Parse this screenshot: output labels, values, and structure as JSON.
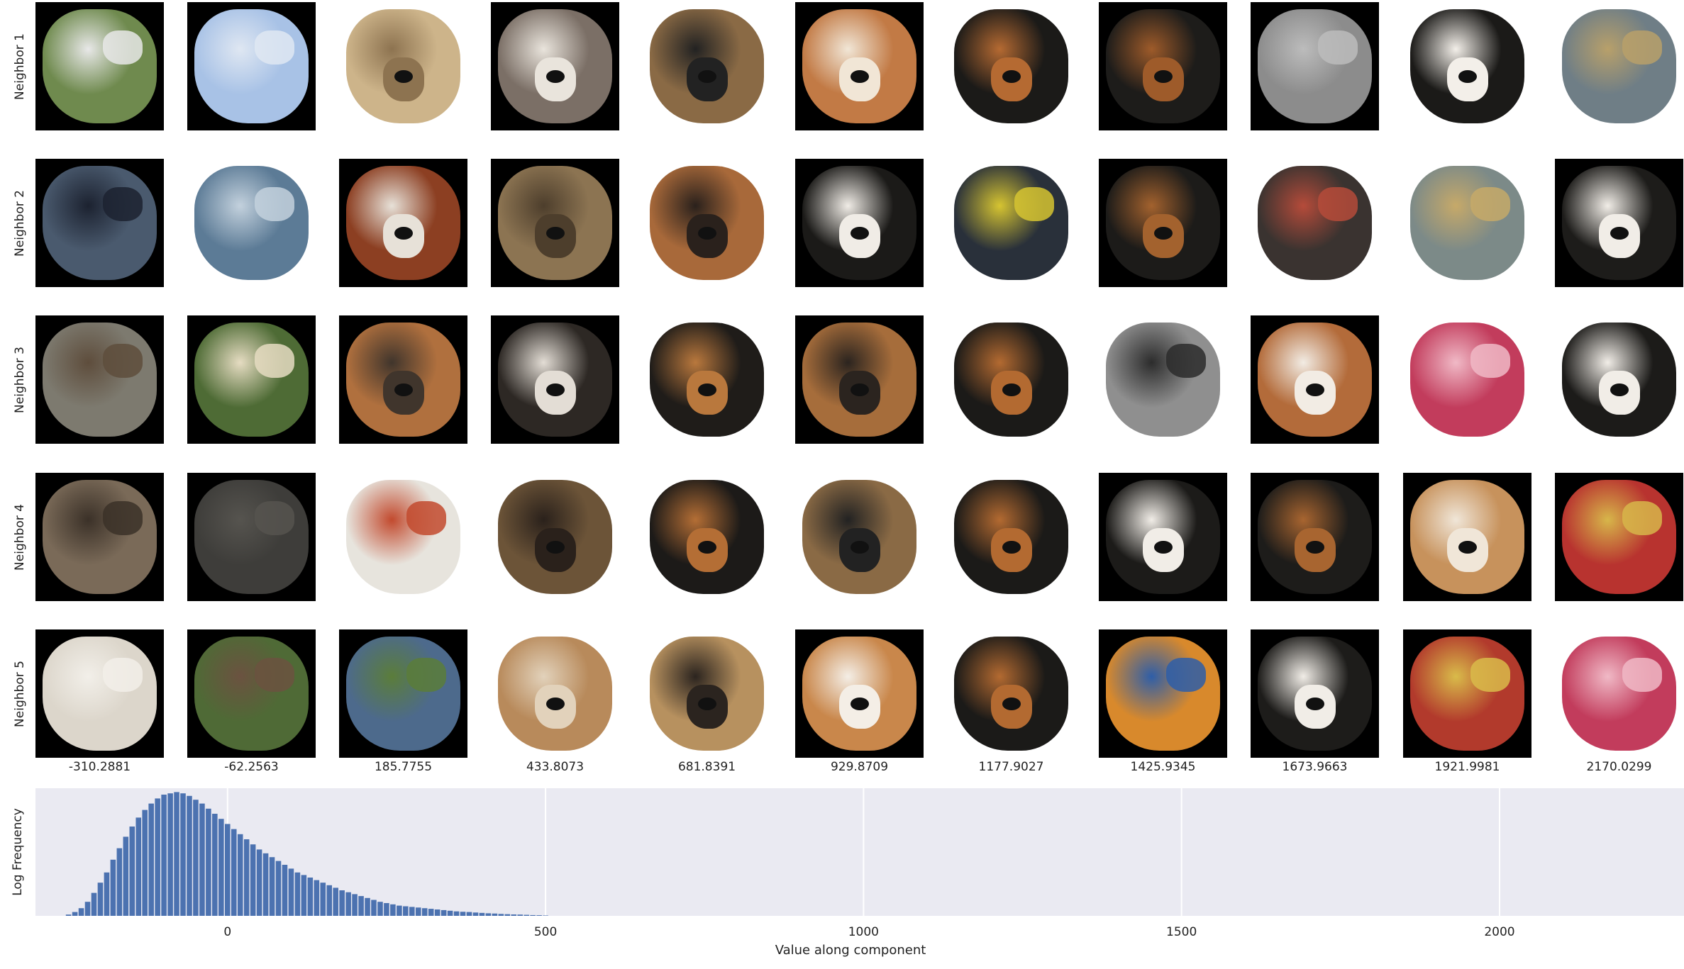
{
  "figure": {
    "row_labels": [
      "Neighbor 1",
      "Neighbor 2",
      "Neighbor 3",
      "Neighbor 4",
      "Neighbor 5"
    ],
    "column_values": [
      "-310.2881",
      "-62.2563",
      "185.7755",
      "433.8073",
      "681.8391",
      "929.8709",
      "1177.9027",
      "1425.9345",
      "1673.9663",
      "1921.9981",
      "2170.0299"
    ],
    "tiles": [
      [
        {
          "depicts": "aerial landscape",
          "bg": "#000000",
          "color": "#6f8a4e",
          "accent": "#e8e8e8",
          "dog": false
        },
        {
          "depicts": "sky with clouds",
          "bg": "#000000",
          "color": "#a8c2e6",
          "accent": "#dfe7f2",
          "dog": false
        },
        {
          "depicts": "terrier dog",
          "bg": "#ffffff",
          "color": "#cdb48a",
          "accent": "#8d7350",
          "dog": true
        },
        {
          "depicts": "merle dog",
          "bg": "#000000",
          "color": "#7b6f66",
          "accent": "#e9e4dc",
          "dog": true
        },
        {
          "depicts": "group of dogs",
          "bg": "#ffffff",
          "color": "#8a6a45",
          "accent": "#222222",
          "dog": true
        },
        {
          "depicts": "orange dog face",
          "bg": "#000000",
          "color": "#c27a45",
          "accent": "#f1e6d6",
          "dog": true
        },
        {
          "depicts": "bernese dog face",
          "bg": "#ffffff",
          "color": "#1b1a18",
          "accent": "#b56a32",
          "dog": true
        },
        {
          "depicts": "bernese puppies",
          "bg": "#000000",
          "color": "#1d1c1a",
          "accent": "#9e5b2a",
          "dog": true
        },
        {
          "depicts": "grey grate pattern",
          "bg": "#000000",
          "color": "#8c8c8c",
          "accent": "#bcbcbc",
          "dog": false
        },
        {
          "depicts": "bernese puppies",
          "bg": "#ffffff",
          "color": "#1b1a18",
          "accent": "#f3efe9",
          "dog": true
        },
        {
          "depicts": "bottle caps",
          "bg": "#ffffff",
          "color": "#6f7e86",
          "accent": "#b8a06a",
          "dog": false
        }
      ],
      [
        {
          "depicts": "dark scene",
          "bg": "#000000",
          "color": "#4a5a6e",
          "accent": "#1c2230",
          "dog": false
        },
        {
          "depicts": "water surface",
          "bg": "#ffffff",
          "color": "#5c7b96",
          "accent": "#c3d1dd",
          "dog": false
        },
        {
          "depicts": "spaniel dogs",
          "bg": "#000000",
          "color": "#8c3f22",
          "accent": "#e7e1d8",
          "dog": true
        },
        {
          "depicts": "yorkshire terrier",
          "bg": "#000000",
          "color": "#8c7452",
          "accent": "#4d3e2c",
          "dog": true
        },
        {
          "depicts": "fluffy dog face",
          "bg": "#ffffff",
          "color": "#a8693a",
          "accent": "#2a211c",
          "dog": true
        },
        {
          "depicts": "bernese dog",
          "bg": "#000000",
          "color": "#1b1a18",
          "accent": "#f0ece6",
          "dog": true
        },
        {
          "depicts": "bottle caps",
          "bg": "#ffffff",
          "color": "#29303a",
          "accent": "#d6c431",
          "dog": false
        },
        {
          "depicts": "bernese puppies",
          "bg": "#000000",
          "color": "#1c1b19",
          "accent": "#a3622e",
          "dog": true
        },
        {
          "depicts": "bottle caps",
          "bg": "#ffffff",
          "color": "#3a3330",
          "accent": "#b54b3a",
          "dog": false
        },
        {
          "depicts": "bottle caps",
          "bg": "#ffffff",
          "color": "#7c8a88",
          "accent": "#c6a969",
          "dog": false
        },
        {
          "depicts": "bernese puppies",
          "bg": "#000000",
          "color": "#1d1c1a",
          "accent": "#f1ede7",
          "dog": true
        }
      ],
      [
        {
          "depicts": "wooden surface",
          "bg": "#000000",
          "color": "#7d7a6f",
          "accent": "#5e4d3c",
          "dog": false
        },
        {
          "depicts": "dogs on grass",
          "bg": "#000000",
          "color": "#4e6b35",
          "accent": "#e6dcc2",
          "dog": false
        },
        {
          "depicts": "small dog face",
          "bg": "#000000",
          "color": "#b0703e",
          "accent": "#40352c",
          "dog": true
        },
        {
          "depicts": "collie face",
          "bg": "#000000",
          "color": "#2d2824",
          "accent": "#e3ddd5",
          "dog": true
        },
        {
          "depicts": "tricolor puppy",
          "bg": "#ffffff",
          "color": "#1f1c19",
          "accent": "#b9783d",
          "dog": true
        },
        {
          "depicts": "chihuahua pair",
          "bg": "#000000",
          "color": "#a66d3b",
          "accent": "#2b241f",
          "dog": true
        },
        {
          "depicts": "bernese dog face",
          "bg": "#ffffff",
          "color": "#1b1a18",
          "accent": "#b36a31",
          "dog": true
        },
        {
          "depicts": "grey grate pattern",
          "bg": "#ffffff",
          "color": "#8f8f8f",
          "accent": "#2c2c2c",
          "dog": false
        },
        {
          "depicts": "cavalier puppies",
          "bg": "#000000",
          "color": "#b36b3a",
          "accent": "#f2ece4",
          "dog": true
        },
        {
          "depicts": "red bottle caps",
          "bg": "#ffffff",
          "color": "#c23c5c",
          "accent": "#f0b9c6",
          "dog": false
        },
        {
          "depicts": "bernese puppies",
          "bg": "#ffffff",
          "color": "#1c1b19",
          "accent": "#f1ede7",
          "dog": true
        }
      ],
      [
        {
          "depicts": "dark interior",
          "bg": "#000000",
          "color": "#7a6a58",
          "accent": "#3b3128",
          "dog": false
        },
        {
          "depicts": "dark animal",
          "bg": "#000000",
          "color": "#3e3d3a",
          "accent": "#56544f",
          "dog": false
        },
        {
          "depicts": "painted van",
          "bg": "#ffffff",
          "color": "#e7e4dd",
          "accent": "#c24a2e",
          "dog": false
        },
        {
          "depicts": "terrier dog",
          "bg": "#ffffff",
          "color": "#6c5438",
          "accent": "#2a211b",
          "dog": true
        },
        {
          "depicts": "swiss mountain dog",
          "bg": "#ffffff",
          "color": "#1c1a18",
          "accent": "#b46e35",
          "dog": true
        },
        {
          "depicts": "group of dogs",
          "bg": "#ffffff",
          "color": "#8a6a45",
          "accent": "#222222",
          "dog": true
        },
        {
          "depicts": "bernese dog face",
          "bg": "#ffffff",
          "color": "#1b1a18",
          "accent": "#b36a31",
          "dog": true
        },
        {
          "depicts": "bernese puppies",
          "bg": "#000000",
          "color": "#1c1b19",
          "accent": "#f1ede7",
          "dog": true
        },
        {
          "depicts": "bernese puppies",
          "bg": "#000000",
          "color": "#1d1c1a",
          "accent": "#a86530",
          "dog": true
        },
        {
          "depicts": "corgi puppies",
          "bg": "#000000",
          "color": "#c7925c",
          "accent": "#f0e6d8",
          "dog": true
        },
        {
          "depicts": "bottle caps",
          "bg": "#000000",
          "color": "#b8332f",
          "accent": "#d7b64a",
          "dog": false
        }
      ],
      [
        {
          "depicts": "white sheet",
          "bg": "#000000",
          "color": "#dcd6cb",
          "accent": "#f2efe9",
          "dog": false
        },
        {
          "depicts": "animals on grass",
          "bg": "#000000",
          "color": "#4f6a36",
          "accent": "#6b5240",
          "dog": false
        },
        {
          "depicts": "dog outdoors",
          "bg": "#000000",
          "color": "#4d6a8c",
          "accent": "#5b7d3a",
          "dog": false
        },
        {
          "depicts": "two dogs",
          "bg": "#ffffff",
          "color": "#b88a5b",
          "accent": "#e2d2bb",
          "dog": true
        },
        {
          "depicts": "golden dogs",
          "bg": "#ffffff",
          "color": "#b7915f",
          "accent": "#2b241f",
          "dog": true
        },
        {
          "depicts": "corgi face",
          "bg": "#000000",
          "color": "#c9874b",
          "accent": "#f4eee6",
          "dog": true
        },
        {
          "depicts": "bernese dog face",
          "bg": "#ffffff",
          "color": "#1b1a18",
          "accent": "#b36a31",
          "dog": true
        },
        {
          "depicts": "colorful bottle caps",
          "bg": "#000000",
          "color": "#d8892c",
          "accent": "#2e5ea8",
          "dog": false
        },
        {
          "depicts": "bernese puppies",
          "bg": "#000000",
          "color": "#1d1c1a",
          "accent": "#f1ede7",
          "dog": true
        },
        {
          "depicts": "bottle caps",
          "bg": "#000000",
          "color": "#b23a2c",
          "accent": "#d9bb4a",
          "dog": false
        },
        {
          "depicts": "red bottle caps",
          "bg": "#ffffff",
          "color": "#c23c5c",
          "accent": "#f0b9c6",
          "dog": false
        }
      ]
    ]
  },
  "chart_data": {
    "type": "bar",
    "title": "",
    "xlabel": "Value along component",
    "ylabel": "Log Frequency",
    "xlim": [
      -302,
      2290
    ],
    "ylim": [
      0,
      100
    ],
    "grid": true,
    "xticks": [
      0,
      500,
      1000,
      1500,
      2000
    ],
    "xtick_labels": [
      "0",
      "500",
      "1000",
      "1500",
      "2000"
    ],
    "bin_width": 10,
    "bin_starts": [
      -255,
      -245,
      -235,
      -225,
      -215,
      -205,
      -195,
      -185,
      -175,
      -165,
      -155,
      -145,
      -135,
      -125,
      -115,
      -105,
      -95,
      -85,
      -75,
      -65,
      -55,
      -45,
      -35,
      -25,
      -15,
      -5,
      5,
      15,
      25,
      35,
      45,
      55,
      65,
      75,
      85,
      95,
      105,
      115,
      125,
      135,
      145,
      155,
      165,
      175,
      185,
      195,
      205,
      215,
      225,
      235,
      245,
      255,
      265,
      275,
      285,
      295,
      305,
      315,
      325,
      335,
      345,
      355,
      365,
      375,
      385,
      395,
      405,
      415,
      425,
      435,
      445,
      455,
      465,
      475,
      485,
      495
    ],
    "values": [
      1,
      3,
      6,
      11,
      18,
      26,
      34,
      44,
      53,
      62,
      70,
      77,
      83,
      88,
      92,
      95,
      96,
      97,
      96,
      94,
      91,
      88,
      84,
      80,
      76,
      72,
      68,
      64,
      60,
      56,
      52,
      49,
      46,
      43,
      40,
      37,
      34,
      32,
      30,
      28,
      26,
      24,
      22,
      20,
      18.5,
      17,
      15.5,
      14,
      12.5,
      11,
      10,
      9,
      8,
      7.5,
      7,
      6.5,
      6,
      5.5,
      5,
      4.5,
      4,
      3.5,
      3.2,
      3,
      2.6,
      2.3,
      2,
      1.8,
      1.5,
      1.3,
      1.1,
      1,
      0.8,
      0.6,
      0.5,
      0.3
    ],
    "bar_color": "#4c72b0",
    "background": "#eaeaf2"
  }
}
